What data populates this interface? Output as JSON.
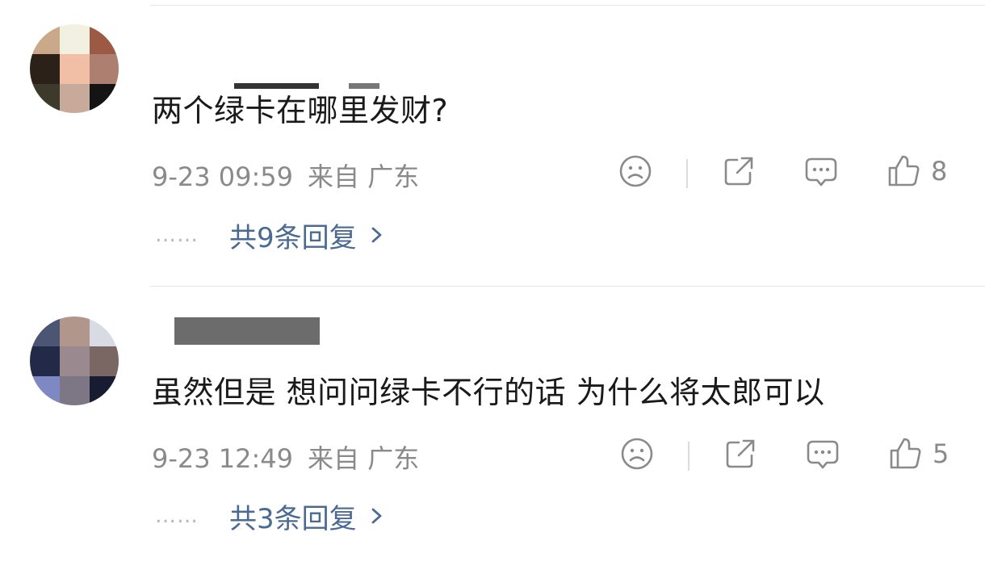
{
  "comments": [
    {
      "text": "两个绿卡在哪里发财?",
      "time": "9-23 09:59",
      "source": "来自 广东",
      "likes": "8",
      "replies": "共9条回复",
      "dots": "……"
    },
    {
      "text": "虽然但是 想问问绿卡不行的话 为什么将太郎可以",
      "time": "9-23 12:49",
      "source": "来自 广东",
      "likes": "5",
      "replies": "共3条回复",
      "dots": "……"
    }
  ],
  "icons": {
    "dislike": "sad-face-icon",
    "share": "share-icon",
    "comment": "comment-icon",
    "like": "thumbs-up-icon",
    "more_replies": "chevron-right-icon"
  },
  "colors": {
    "text": "#1a1a1a",
    "meta": "#8a8a8a",
    "link": "#4a6a93",
    "divider": "#e6e6e6"
  }
}
